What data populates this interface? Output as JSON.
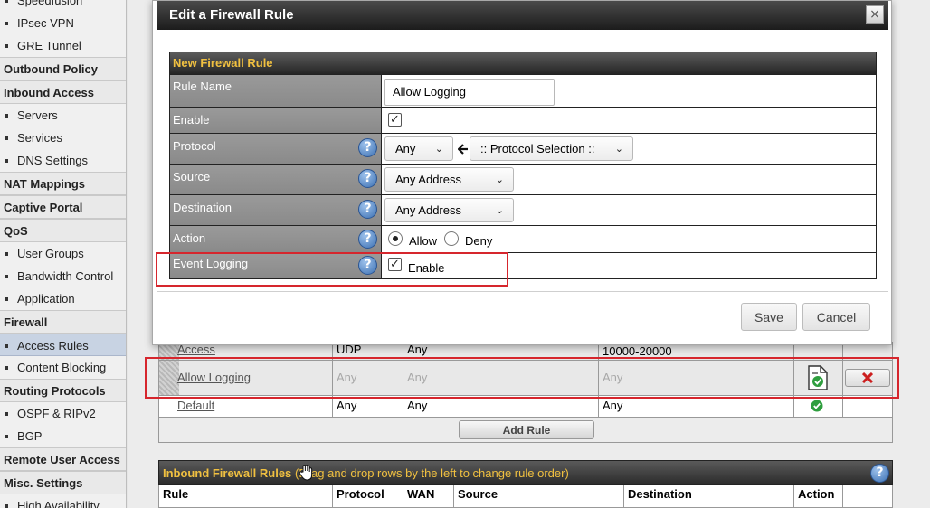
{
  "sidebar": {
    "items": [
      {
        "type": "item",
        "label": "Speedfusion"
      },
      {
        "type": "item",
        "label": "IPsec VPN"
      },
      {
        "type": "item",
        "label": "GRE Tunnel"
      },
      {
        "type": "head",
        "label": "Outbound Policy"
      },
      {
        "type": "head",
        "label": "Inbound Access"
      },
      {
        "type": "item",
        "label": "Servers"
      },
      {
        "type": "item",
        "label": "Services"
      },
      {
        "type": "item",
        "label": "DNS Settings"
      },
      {
        "type": "head",
        "label": "NAT Mappings"
      },
      {
        "type": "head",
        "label": "Captive Portal"
      },
      {
        "type": "head",
        "label": "QoS"
      },
      {
        "type": "item",
        "label": "User Groups"
      },
      {
        "type": "item",
        "label": "Bandwidth Control"
      },
      {
        "type": "item",
        "label": "Application"
      },
      {
        "type": "head",
        "label": "Firewall"
      },
      {
        "type": "item",
        "label": "Access Rules",
        "active": true
      },
      {
        "type": "item",
        "label": "Content Blocking"
      },
      {
        "type": "head",
        "label": "Routing Protocols"
      },
      {
        "type": "item",
        "label": "OSPF & RIPv2"
      },
      {
        "type": "item",
        "label": "BGP"
      },
      {
        "type": "head",
        "label": "Remote User Access"
      },
      {
        "type": "head",
        "label": "Misc. Settings"
      },
      {
        "type": "item",
        "label": "High Availability"
      }
    ]
  },
  "dialog": {
    "title": "Edit a Firewall Rule",
    "close_symbol": "×",
    "section_title": "New Firewall Rule",
    "rule_name": {
      "label": "Rule Name",
      "value": "Allow Logging"
    },
    "enable": {
      "label": "Enable",
      "checked": true
    },
    "protocol": {
      "label": "Protocol",
      "value": "Any",
      "selection": ":: Protocol Selection ::"
    },
    "source": {
      "label": "Source",
      "value": "Any Address"
    },
    "destination": {
      "label": "Destination",
      "value": "Any Address"
    },
    "action": {
      "label": "Action",
      "options": [
        "Allow",
        "Deny"
      ],
      "selected": "Allow"
    },
    "event_logging": {
      "label": "Event Logging",
      "option_label": "Enable",
      "checked": true
    },
    "save_label": "Save",
    "cancel_label": "Cancel"
  },
  "outbound_rows": {
    "partial": {
      "name": "Access",
      "protocol": "UDP",
      "source": "Any",
      "destination": "10000-20000"
    },
    "allow_logging": {
      "name": "Allow Logging",
      "protocol": "Any",
      "source": "Any",
      "destination": "Any"
    },
    "default": {
      "name": "Default",
      "protocol": "Any",
      "source": "Any",
      "destination": "Any"
    },
    "add_rule_label": "Add Rule"
  },
  "inbound": {
    "title": "Inbound Firewall Rules",
    "hint": "(Drag and drop rows by the left to change rule order)",
    "columns": [
      "Rule",
      "Protocol",
      "WAN",
      "Source",
      "Destination",
      "Action"
    ]
  },
  "colors": {
    "highlight": "#d6262d",
    "header_text": "#f0c040",
    "active_nav": "#c8d3e3"
  }
}
